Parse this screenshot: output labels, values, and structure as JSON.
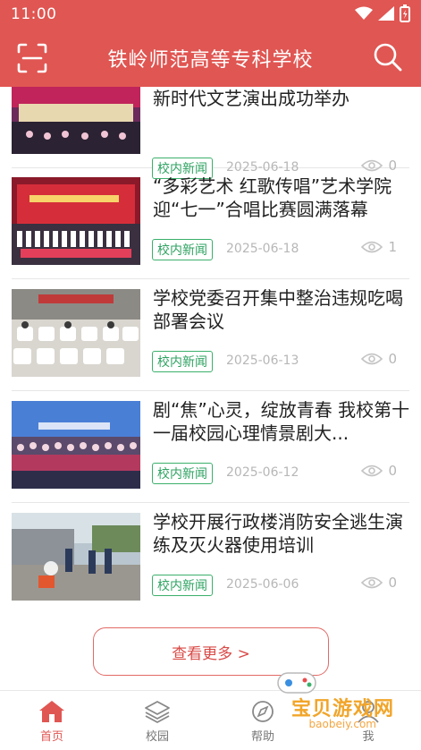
{
  "status": {
    "time": "11:00"
  },
  "appbar": {
    "title": "铁岭师范高等专科学校"
  },
  "list": [
    {
      "headline": "新时代文艺演出成功举办",
      "tag": "校内新闻",
      "date": "2025-06-18",
      "views": "0"
    },
    {
      "headline": "“多彩艺术 红歌传唱”艺术学院迎“七一”合唱比赛圆满落幕",
      "tag": "校内新闻",
      "date": "2025-06-18",
      "views": "1"
    },
    {
      "headline": "学校党委召开集中整治违规吃喝部署会议",
      "tag": "校内新闻",
      "date": "2025-06-13",
      "views": "0"
    },
    {
      "headline": "剧“焦”心灵，绽放青春 我校第十一届校园心理情景剧大...",
      "tag": "校内新闻",
      "date": "2025-06-12",
      "views": "0"
    },
    {
      "headline": "学校开展行政楼消防安全逃生演练及灭火器使用培训",
      "tag": "校内新闻",
      "date": "2025-06-06",
      "views": "0"
    }
  ],
  "more_label": "查看更多 >",
  "tabs": [
    {
      "label": "首页"
    },
    {
      "label": "校园"
    },
    {
      "label": "帮助"
    },
    {
      "label": "我"
    }
  ],
  "watermark": {
    "text": "宝贝游戏网",
    "sub": "baobeiy.com"
  },
  "colors": {
    "brand": "#e05652",
    "tag_green": "#2ea261",
    "muted": "#b7b7b7"
  }
}
